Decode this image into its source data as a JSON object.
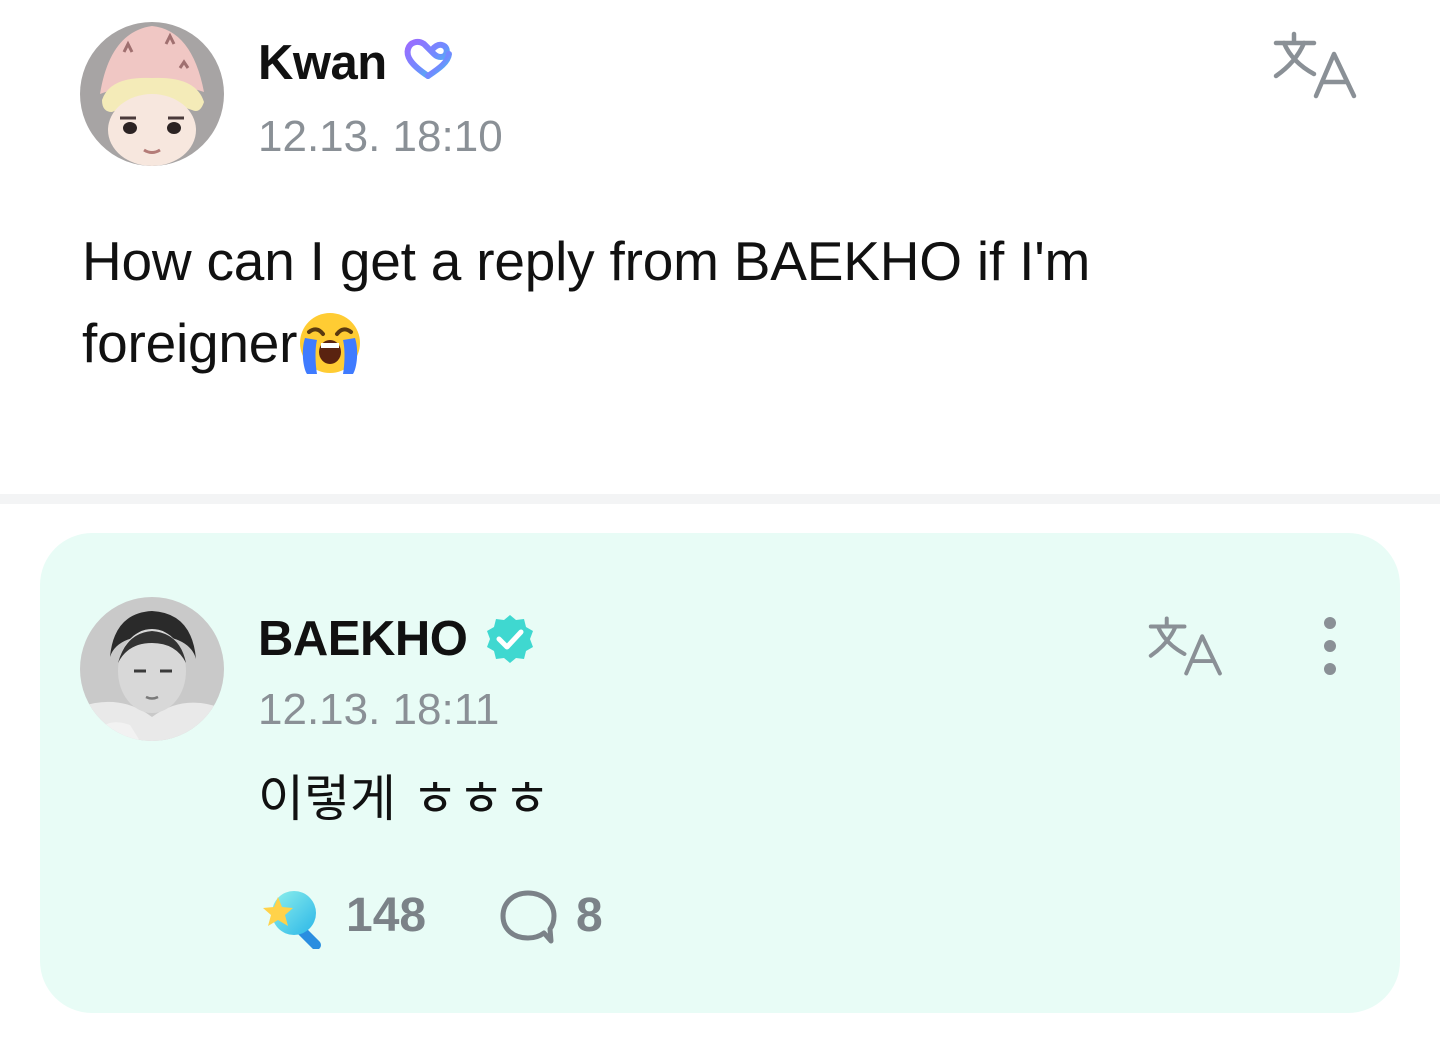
{
  "post": {
    "author": "Kwan",
    "timestamp": "12.13. 18:10",
    "body": "How can I get a reply from BAEKHO if I'm foreigner",
    "emoji": "loudly-crying-face",
    "icons": {
      "avatar": "plush-doll-avatar",
      "badge": "fan-membership-heart-icon",
      "translate": "translate-icon"
    }
  },
  "reply": {
    "author": "BAEKHO",
    "timestamp": "12.13. 18:11",
    "body": "이렇게 ㅎㅎㅎ",
    "likes": "148",
    "comments": "8",
    "icons": {
      "avatar": "artist-photo-avatar",
      "badge": "verified-check-icon",
      "translate": "translate-icon",
      "more": "more-vertical-icon",
      "like": "star-magnifier-like-icon",
      "comment": "speech-bubble-icon"
    }
  },
  "colors": {
    "reply_background": "#e8fcf6",
    "verified": "#3fd8d0",
    "muted_text": "#8a9096",
    "icon_gray": "#7b8288",
    "divider": "#f3f4f5"
  }
}
